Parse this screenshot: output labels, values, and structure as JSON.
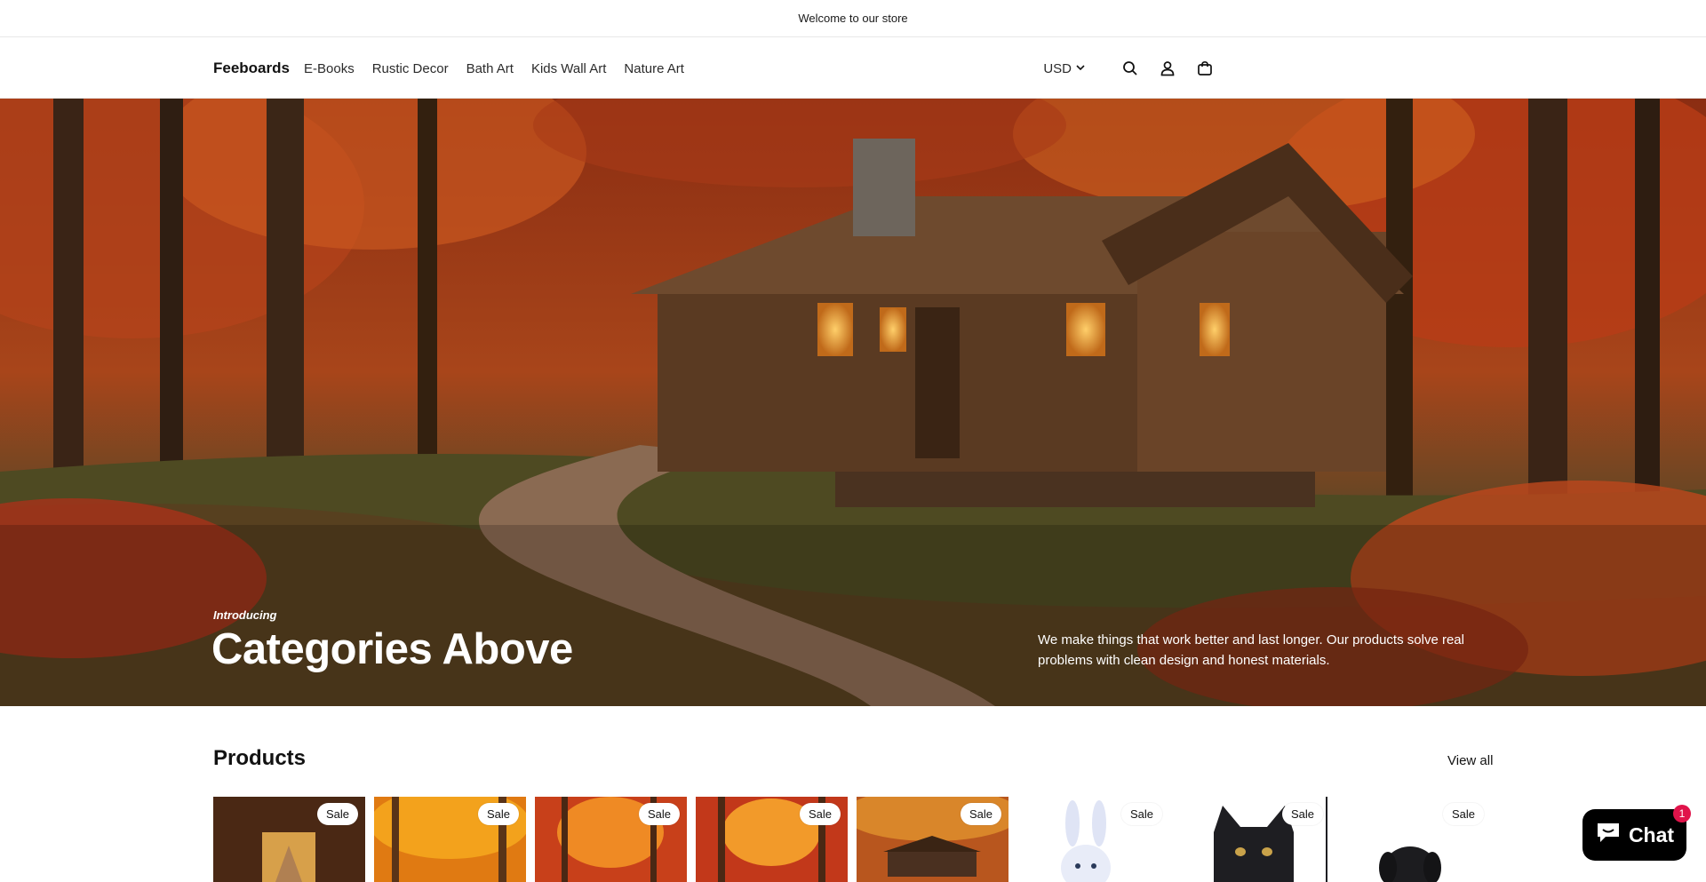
{
  "announcement": {
    "text": "Welcome to our store"
  },
  "header": {
    "brand": "Feeboards",
    "nav": [
      {
        "label": "E-Books"
      },
      {
        "label": "Rustic Decor"
      },
      {
        "label": "Bath Art"
      },
      {
        "label": "Kids Wall Art"
      },
      {
        "label": "Nature Art"
      }
    ],
    "currency": "USD",
    "icons": [
      "search-icon",
      "account-icon",
      "cart-icon"
    ]
  },
  "hero": {
    "kicker": "Introducing",
    "title": "Categories Above",
    "description": "We make things that work better and last longer. Our products solve real problems with clean design and honest materials."
  },
  "products": {
    "title": "Products",
    "view_all": "View all",
    "items": [
      {
        "badge": "Sale",
        "image": "covered-bridge-autumn"
      },
      {
        "badge": "Sale",
        "image": "autumn-forest-path"
      },
      {
        "badge": "Sale",
        "image": "red-autumn-forest-road"
      },
      {
        "badge": "Sale",
        "image": "red-autumn-forest-path"
      },
      {
        "badge": "Sale",
        "image": "cabin-in-autumn-woods"
      },
      {
        "badge": "Sale",
        "image": "bunny-illustration"
      },
      {
        "badge": "Sale",
        "image": "black-kitten-illustration"
      },
      {
        "badge": "Sale",
        "image": "black-puppy-illustration"
      }
    ]
  },
  "chat": {
    "label": "Chat",
    "badge": "1"
  },
  "colors": {
    "accent": "#121212",
    "chat_bg": "#000000",
    "badge": "#e0134a"
  }
}
